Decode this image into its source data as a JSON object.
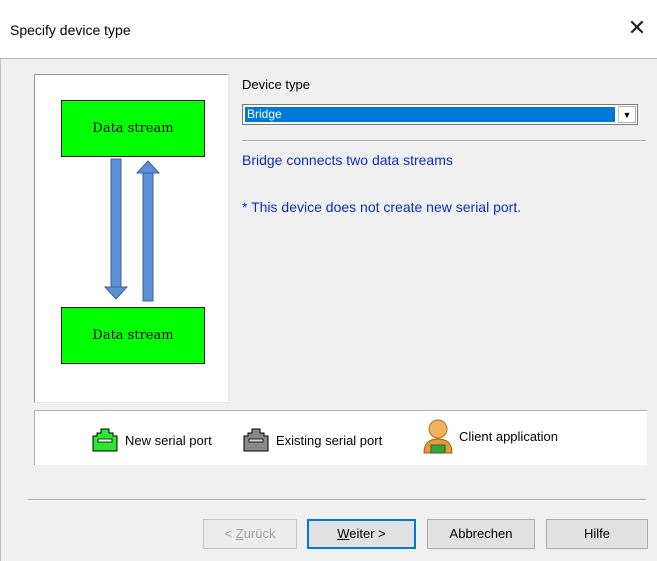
{
  "window": {
    "title": "Specify device type"
  },
  "diagram": {
    "top_stream": "Data stream",
    "bottom_stream": "Data stream"
  },
  "device_type": {
    "label": "Device type",
    "selected": "Bridge"
  },
  "description": {
    "line1": "Bridge connects two data streams",
    "line2": "* This device does not create new serial port."
  },
  "legend": {
    "new_port": "New serial port",
    "existing_port": "Existing serial port",
    "client_app": "Client application"
  },
  "buttons": {
    "back": {
      "pre": "< ",
      "mnemonic": "Z",
      "rest": "urück"
    },
    "next": {
      "mnemonic": "W",
      "rest": "eiter >"
    },
    "cancel": "Abbrechen",
    "help": "Hilfe"
  },
  "colors": {
    "stream": "#00ff00",
    "selection": "#0078d7",
    "info_text": "#0a2bc4",
    "arrow": "#5b8fd6"
  }
}
